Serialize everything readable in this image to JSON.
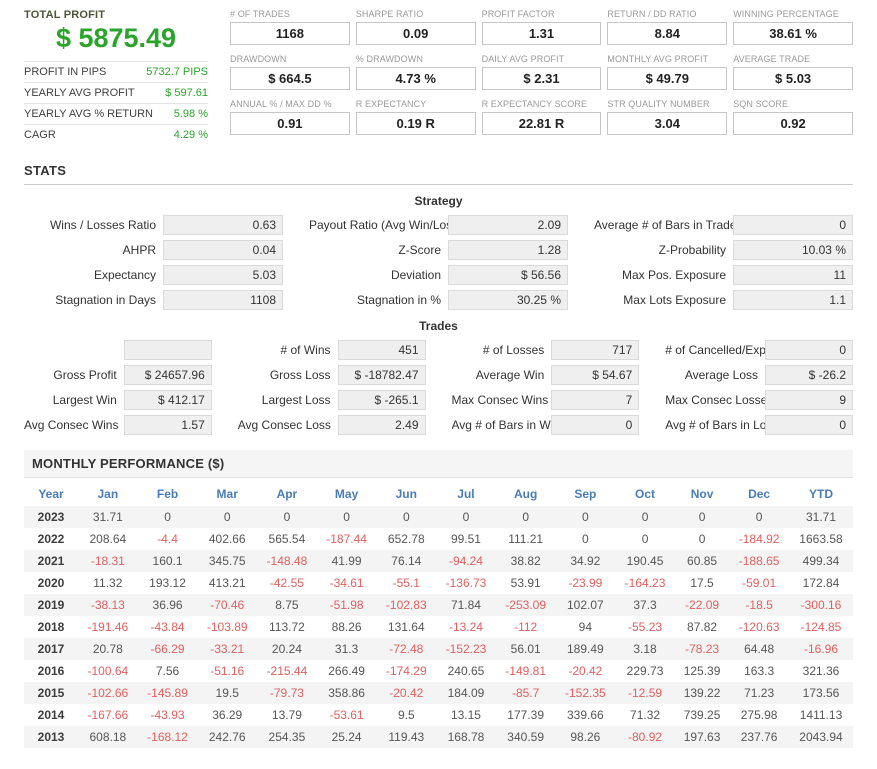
{
  "colors": {
    "profit_green": "#2aa42a",
    "negative_red": "#e25f5f",
    "table_header_blue": "#4a7db8"
  },
  "summary": {
    "total_profit_label": "TOTAL PROFIT",
    "total_profit_value": "$ 5875.49",
    "rows": [
      {
        "label": "PROFIT IN PIPS",
        "value": "5732.7 PIPS"
      },
      {
        "label": "YEARLY AVG PROFIT",
        "value": "$ 597.61"
      },
      {
        "label": "YEARLY AVG % RETURN",
        "value": "5.98 %"
      },
      {
        "label": "CAGR",
        "value": "4.29 %"
      }
    ]
  },
  "kpis": [
    {
      "label": "# OF TRADES",
      "value": "1168"
    },
    {
      "label": "SHARPE RATIO",
      "value": "0.09"
    },
    {
      "label": "PROFIT FACTOR",
      "value": "1.31"
    },
    {
      "label": "RETURN / DD RATIO",
      "value": "8.84"
    },
    {
      "label": "WINNING PERCENTAGE",
      "value": "38.61 %"
    },
    {
      "label": "DRAWDOWN",
      "value": "$ 664.5"
    },
    {
      "label": "% DRAWDOWN",
      "value": "4.73 %"
    },
    {
      "label": "DAILY AVG PROFIT",
      "value": "$ 2.31"
    },
    {
      "label": "MONTHLY AVG PROFIT",
      "value": "$ 49.79"
    },
    {
      "label": "AVERAGE TRADE",
      "value": "$ 5.03"
    },
    {
      "label": "ANNUAL % / MAX DD %",
      "value": "0.91"
    },
    {
      "label": "R EXPECTANCY",
      "value": "0.19 R"
    },
    {
      "label": "R EXPECTANCY SCORE",
      "value": "22.81 R"
    },
    {
      "label": "STR QUALITY NUMBER",
      "value": "3.04"
    },
    {
      "label": "SQN SCORE",
      "value": "0.92"
    }
  ],
  "stats_section": {
    "title": "STATS",
    "strategy": {
      "title": "Strategy",
      "rows": [
        [
          {
            "label": "Wins / Losses Ratio",
            "value": "0.63"
          },
          {
            "label": "Payout Ratio (Avg Win/Loss)",
            "value": "2.09"
          },
          {
            "label": "Average # of Bars in Trade",
            "value": "0"
          }
        ],
        [
          {
            "label": "AHPR",
            "value": "0.04"
          },
          {
            "label": "Z-Score",
            "value": "1.28"
          },
          {
            "label": "Z-Probability",
            "value": "10.03 %"
          }
        ],
        [
          {
            "label": "Expectancy",
            "value": "5.03"
          },
          {
            "label": "Deviation",
            "value": "$ 56.56"
          },
          {
            "label": "Max Pos. Exposure",
            "value": "11"
          }
        ],
        [
          {
            "label": "Stagnation in Days",
            "value": "1108"
          },
          {
            "label": "Stagnation in %",
            "value": "30.25 %"
          },
          {
            "label": "Max Lots Exposure",
            "value": "1.1"
          }
        ]
      ]
    },
    "trades": {
      "title": "Trades",
      "rows": [
        [
          {
            "label": "",
            "value": ""
          },
          {
            "label": "# of Wins",
            "value": "451"
          },
          {
            "label": "# of Losses",
            "value": "717"
          },
          {
            "label": "# of Cancelled/Expired",
            "value": "0"
          }
        ],
        [
          {
            "label": "Gross Profit",
            "value": "$ 24657.96"
          },
          {
            "label": "Gross Loss",
            "value": "$ -18782.47"
          },
          {
            "label": "Average Win",
            "value": "$ 54.67"
          },
          {
            "label": "Average Loss",
            "value": "$ -26.2"
          }
        ],
        [
          {
            "label": "Largest Win",
            "value": "$ 412.17"
          },
          {
            "label": "Largest Loss",
            "value": "$ -265.1"
          },
          {
            "label": "Max Consec Wins",
            "value": "7"
          },
          {
            "label": "Max Consec Losses",
            "value": "9"
          }
        ],
        [
          {
            "label": "Avg Consec Wins",
            "value": "1.57"
          },
          {
            "label": "Avg Consec Loss",
            "value": "2.49"
          },
          {
            "label": "Avg # of Bars in Wins",
            "value": "0"
          },
          {
            "label": "Avg # of Bars in Losses",
            "value": "0"
          }
        ]
      ]
    }
  },
  "monthly": {
    "title": "MONTHLY PERFORMANCE ($)",
    "columns": [
      "Year",
      "Jan",
      "Feb",
      "Mar",
      "Apr",
      "May",
      "Jun",
      "Jul",
      "Aug",
      "Sep",
      "Oct",
      "Nov",
      "Dec",
      "YTD"
    ],
    "rows": [
      {
        "year": "2023",
        "values": [
          "31.71",
          "0",
          "0",
          "0",
          "0",
          "0",
          "0",
          "0",
          "0",
          "0",
          "0",
          "0",
          "31.71"
        ]
      },
      {
        "year": "2022",
        "values": [
          "208.64",
          "-4.4",
          "402.66",
          "565.54",
          "-187.44",
          "652.78",
          "99.51",
          "111.21",
          "0",
          "0",
          "0",
          "-184.92",
          "1663.58"
        ]
      },
      {
        "year": "2021",
        "values": [
          "-18.31",
          "160.1",
          "345.75",
          "-148.48",
          "41.99",
          "76.14",
          "-94.24",
          "38.82",
          "34.92",
          "190.45",
          "60.85",
          "-188.65",
          "499.34"
        ]
      },
      {
        "year": "2020",
        "values": [
          "11.32",
          "193.12",
          "413.21",
          "-42.55",
          "-34.61",
          "-55.1",
          "-136.73",
          "53.91",
          "-23.99",
          "-164.23",
          "17.5",
          "-59.01",
          "172.84"
        ]
      },
      {
        "year": "2019",
        "values": [
          "-38.13",
          "36.96",
          "-70.46",
          "8.75",
          "-51.98",
          "-102.83",
          "71.84",
          "-253.09",
          "102.07",
          "37.3",
          "-22.09",
          "-18.5",
          "-300.16"
        ]
      },
      {
        "year": "2018",
        "values": [
          "-191.46",
          "-43.84",
          "-103.89",
          "113.72",
          "88.26",
          "131.64",
          "-13.24",
          "-112",
          "94",
          "-55.23",
          "87.82",
          "-120.63",
          "-124.85"
        ]
      },
      {
        "year": "2017",
        "values": [
          "20.78",
          "-66.29",
          "-33.21",
          "20.24",
          "31.3",
          "-72.48",
          "-152.23",
          "56.01",
          "189.49",
          "3.18",
          "-78.23",
          "64.48",
          "-16.96"
        ]
      },
      {
        "year": "2016",
        "values": [
          "-100.64",
          "7.56",
          "-51.16",
          "-215.44",
          "266.49",
          "-174.29",
          "240.65",
          "-149.81",
          "-20.42",
          "229.73",
          "125.39",
          "163.3",
          "321.36"
        ]
      },
      {
        "year": "2015",
        "values": [
          "-102.66",
          "-145.89",
          "19.5",
          "-79.73",
          "358.86",
          "-20.42",
          "184.09",
          "-85.7",
          "-152.35",
          "-12.59",
          "139.22",
          "71.23",
          "173.56"
        ]
      },
      {
        "year": "2014",
        "values": [
          "-167.66",
          "-43.93",
          "36.29",
          "13.79",
          "-53.61",
          "9.5",
          "13.15",
          "177.39",
          "339.66",
          "71.32",
          "739.25",
          "275.98",
          "1411.13"
        ]
      },
      {
        "year": "2013",
        "values": [
          "608.18",
          "-168.12",
          "242.76",
          "254.35",
          "25.24",
          "119.43",
          "168.78",
          "340.59",
          "98.26",
          "-80.92",
          "197.63",
          "237.76",
          "2043.94"
        ]
      }
    ]
  }
}
